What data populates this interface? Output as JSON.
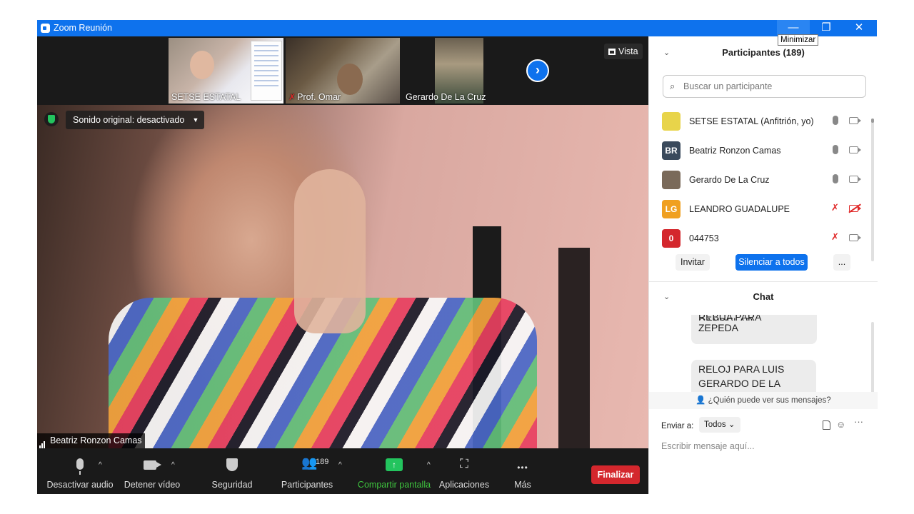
{
  "window": {
    "title": "Zoom Reunión",
    "tooltip": "Minimizar",
    "min_glyph": "—",
    "max_glyph": "❐",
    "close_glyph": "✕"
  },
  "thumbnails": [
    {
      "name": "SETSE ESTATAL",
      "muted": false
    },
    {
      "name": "Prof. Omar",
      "muted": true
    },
    {
      "name": "Gerardo De La Cruz",
      "muted": false
    }
  ],
  "thumb_mute_glyph": "✗",
  "view_button": "Vista",
  "next_arrow": "›",
  "original_sound": {
    "label": "Sonido original: desactivado",
    "caret": "▼"
  },
  "main_speaker": "Beatriz Ronzon Camas",
  "toolbar": {
    "audio": "Desactivar audio",
    "video": "Detener vídeo",
    "security": "Seguridad",
    "participants": "Participantes",
    "participants_count": "189",
    "share": "Compartir pantalla",
    "share_glyph": "↑",
    "apps": "Aplicaciones",
    "apps_glyph": "⛶",
    "more": "Más",
    "more_glyph": "•••",
    "people_glyph": "👥",
    "caret": "^",
    "end": "Finalizar"
  },
  "participants_panel": {
    "title": "Participantes (189)",
    "collapse_glyph": "⌄",
    "search_placeholder": "Buscar un participante",
    "search_glyph": "⌕",
    "mic_off_glyph": "✗",
    "list": [
      {
        "name": "SETSE ESTATAL (Anfitrión, yo)",
        "initials": "",
        "color": "#e8d44a",
        "mic": "on",
        "cam": "on"
      },
      {
        "name": "Beatriz Ronzon Camas",
        "initials": "BR",
        "color": "#3a4a5c",
        "mic": "on",
        "cam": "on"
      },
      {
        "name": "Gerardo De La Cruz",
        "initials": "",
        "color": "#7a6a5a",
        "mic": "on",
        "cam": "on"
      },
      {
        "name": "LEANDRO GUADALUPE",
        "initials": "LG",
        "color": "#f0a020",
        "mic": "off",
        "cam": "off"
      },
      {
        "name": "044753",
        "initials": "0",
        "color": "#d4272d",
        "mic": "off",
        "cam": "on"
      }
    ],
    "invite": "Invitar",
    "mute_all": "Silenciar a todos",
    "more": "..."
  },
  "chat_panel": {
    "title": "Chat",
    "messages": [
      {
        "cut_line": "REBUA PARA CANDELAR",
        "text": "ZEPEDA"
      },
      {
        "text": "RELOJ PARA  LUIS GERARDO DE LA CRUZ"
      }
    ],
    "who_sees": "¿Quién puede ver sus mensajes?",
    "who_glyph": "👤",
    "send_to_label": "Enviar a:",
    "send_to_value": "Todos",
    "send_to_caret": "⌄",
    "emoji_glyph": "☺",
    "more_glyph": "···",
    "input_placeholder": "Escribir mensaje aquí..."
  },
  "colors": {
    "zoom_blue": "#0e72ed",
    "end_red": "#d4272d",
    "share_green": "#23c45e",
    "mute_red": "#e02828"
  }
}
